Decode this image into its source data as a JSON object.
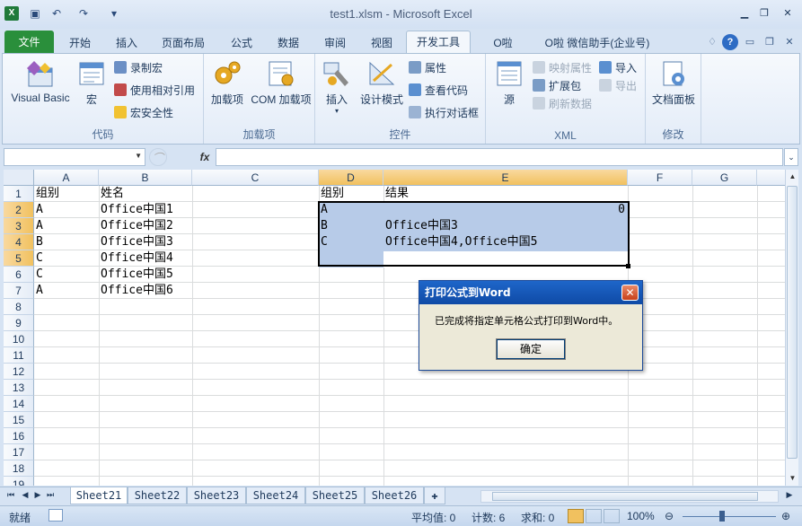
{
  "window": {
    "title": "test1.xlsm - Microsoft Excel",
    "app_icon": "X"
  },
  "tabs": [
    "文件",
    "开始",
    "插入",
    "页面布局",
    "公式",
    "数据",
    "审阅",
    "视图",
    "开发工具",
    "O啦",
    "O啦 微信助手(企业号)"
  ],
  "active_tab": "开发工具",
  "ribbon": {
    "code": {
      "label": "代码",
      "visual_basic": "Visual Basic",
      "macros": "宏",
      "record_macro": "录制宏",
      "relative_ref": "使用相对引用",
      "macro_security": "宏安全性"
    },
    "addins": {
      "label": "加载项",
      "addins_btn": "加载项",
      "com_addins": "COM 加载项"
    },
    "controls": {
      "label": "控件",
      "insert": "插入",
      "design_mode": "设计模式",
      "properties": "属性",
      "view_code": "查看代码",
      "run_dialog": "执行对话框"
    },
    "xml": {
      "label": "XML",
      "source": "源",
      "map_props": "映射属性",
      "expansion_packs": "扩展包",
      "refresh_data": "刷新数据",
      "import": "导入",
      "export": "导出"
    },
    "modify": {
      "label": "修改",
      "doc_panel": "文档面板"
    }
  },
  "formula_bar": {
    "name_box": "",
    "fx_label": "fx",
    "formula": ""
  },
  "columns": [
    "A",
    "B",
    "C",
    "D",
    "E",
    "F",
    "G"
  ],
  "rows": [
    "1",
    "2",
    "3",
    "4",
    "5",
    "6",
    "7",
    "8",
    "9",
    "10",
    "11",
    "12",
    "13",
    "14",
    "15",
    "16",
    "17",
    "18",
    "19"
  ],
  "cells": {
    "A1": "组别",
    "B1": "姓名",
    "D1": "组别",
    "E1": "结果",
    "A2": "A",
    "B2": "Office中国1",
    "D2": "A",
    "E2": "0",
    "A3": "A",
    "B3": "Office中国2",
    "D3": "B",
    "E3": "Office中国3",
    "A4": "B",
    "B4": "Office中国3",
    "D4": "C",
    "E4": "Office中国4,Office中国5",
    "A5": "C",
    "B5": "Office中国4",
    "A6": "C",
    "B6": "Office中国5",
    "A7": "A",
    "B7": "Office中国6"
  },
  "sheets": [
    "Sheet21",
    "Sheet22",
    "Sheet23",
    "Sheet24",
    "Sheet25",
    "Sheet26"
  ],
  "active_sheet": "Sheet21",
  "status": {
    "ready": "就绪",
    "average": "平均值: 0",
    "count": "计数: 6",
    "sum": "求和: 0",
    "zoom": "100%"
  },
  "dialog": {
    "title": "打印公式到Word",
    "message": "已完成将指定单元格公式打印到Word中。",
    "ok": "确定",
    "close": "✕"
  },
  "colors": {
    "file_tab": "#2a8f3b",
    "selection": "#b7cbe8",
    "header_selected": "#f1c15f",
    "dialog_title": "#1e66c9"
  }
}
